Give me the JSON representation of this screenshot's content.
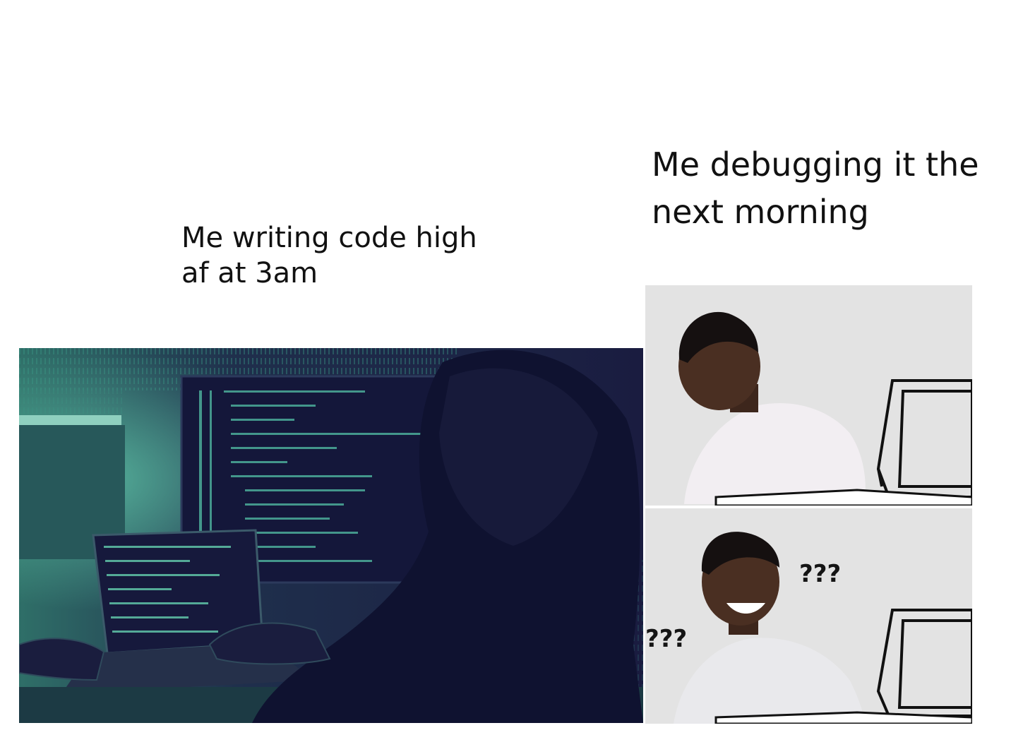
{
  "captions": {
    "left": [
      "Me writing code high",
      "af at 3am"
    ],
    "right": [
      "Me debugging it the",
      "next morning"
    ]
  },
  "panels": {
    "hacker": {
      "colors": {
        "background": "#1d1f44",
        "accent": "#3b9a86",
        "glow": "#5fc4a8"
      }
    },
    "confused": {
      "question_marks_top": "???",
      "question_marks_bottom": "???",
      "colors": {
        "background": "#e3e3e3",
        "skin": "#4a2f22",
        "shirt": "#f2eef2"
      }
    }
  }
}
